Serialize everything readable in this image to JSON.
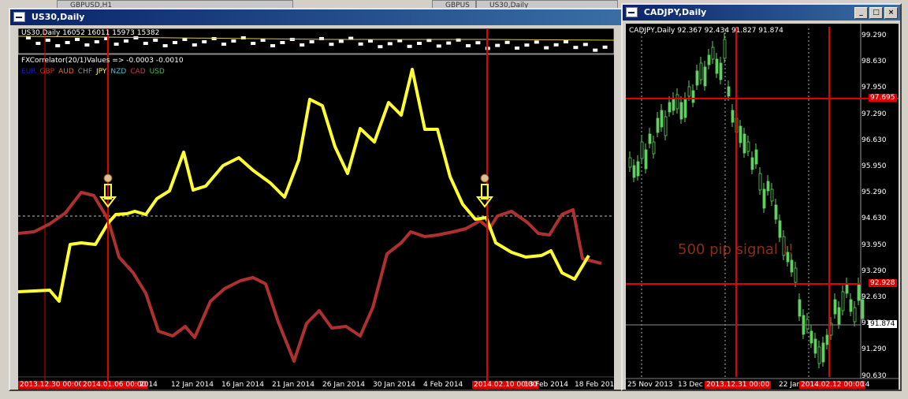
{
  "background_tabs": [
    {
      "label": "GBPUSD,H1"
    },
    {
      "label": "GBPUS"
    },
    {
      "label": "US30,Daily"
    }
  ],
  "win_left": {
    "title": "US30,Daily",
    "header_line": "US30,Daily  16052 16011 15973 15382",
    "indicator_line": "FXCorrelator(20/1)Values =>  -0.0003  -0.0010",
    "legend": [
      {
        "label": "EUR",
        "color": "#1a1ad0"
      },
      {
        "label": "GBP",
        "color": "#c83020"
      },
      {
        "label": "AUD",
        "color": "#e07040"
      },
      {
        "label": "CHF",
        "color": "#909090"
      },
      {
        "label": "JPY",
        "color": "#ffff30"
      },
      {
        "label": "NZD",
        "color": "#40c0d0"
      },
      {
        "label": "CAD",
        "color": "#c04040"
      },
      {
        "label": "USD",
        "color": "#40c040"
      }
    ],
    "x_labels": [
      "2013.12.30 00:00",
      "2014.01.06 00:00",
      "2014",
      "12 Jan 2014",
      "16 Jan 2014",
      "21 Jan 2014",
      "26 Jan 2014",
      "30 Jan 2014",
      "4 Feb 2014",
      "2014.02.10 00:00",
      "13 Feb 2014",
      "18 Feb 2014"
    ]
  },
  "win_right": {
    "title": "CADJPY,Daily",
    "header_line": "CADJPY,Daily  92.367 92.434 91.827 91.874",
    "price_labels": [
      "99.290",
      "98.630",
      "97.950",
      "97.290",
      "96.630",
      "95.950",
      "95.290",
      "94.630",
      "93.950",
      "93.290",
      "92.630",
      "91.950",
      "91.290",
      "90.630"
    ],
    "red_price_labels": [
      "97.695",
      "92.928"
    ],
    "current_price": "91.874",
    "annotation": "500 pip signal !!",
    "x_labels": [
      "25 Nov 2013",
      "13 Dec 2",
      "2013.12.31 00:00",
      "22 Jan",
      "2014.02.12 00:00",
      "14"
    ]
  },
  "colors": {
    "yellow_line": "#ffff30",
    "red_line": "#b03030",
    "signal_red": "#e00000",
    "candle_green": "#60d060"
  }
}
